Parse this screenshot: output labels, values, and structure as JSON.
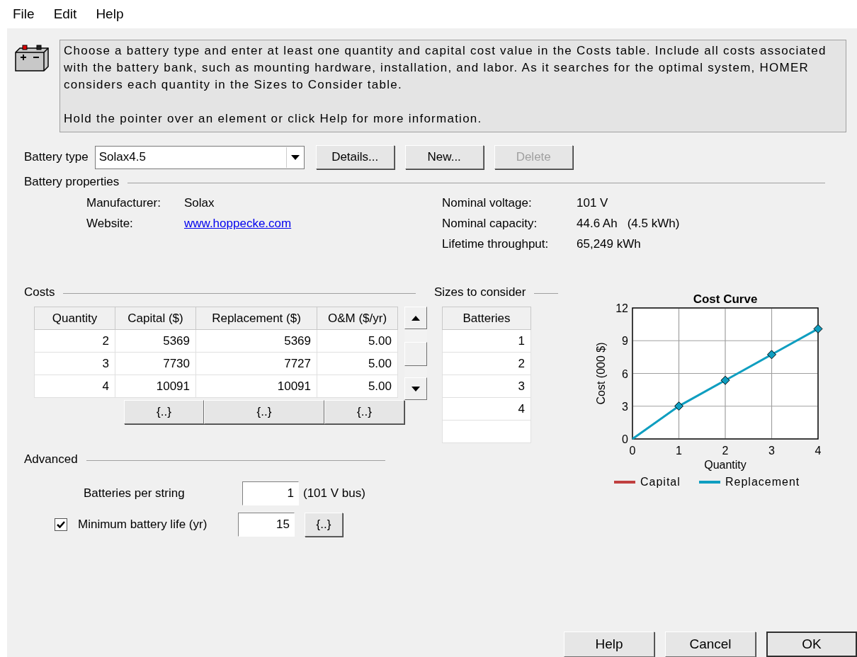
{
  "menu": [
    {
      "label": "File"
    },
    {
      "label": "Edit"
    },
    {
      "label": "Help"
    }
  ],
  "info": {
    "paragraphs": [
      "Choose a battery type and enter at least one quantity and capital cost value in the Costs table. Include all costs associated with the battery bank, such as mounting hardware, installation, and labor. As it searches for the optimal system, HOMER considers each quantity in the Sizes to Consider table.",
      "Hold the pointer over an element or click Help for more information."
    ]
  },
  "battery_type": {
    "label": "Battery type",
    "value": "Solax4.5",
    "buttons": [
      {
        "label": "Details...",
        "disabled": false
      },
      {
        "label": "New...",
        "disabled": false
      },
      {
        "label": "Delete",
        "disabled": true
      }
    ]
  },
  "battery_properties": {
    "title": "Battery properties",
    "left": [
      {
        "label": "Manufacturer:",
        "value": "Solax",
        "kind": "text"
      },
      {
        "label": "Website:",
        "value": "www.hoppecke.com",
        "kind": "link"
      }
    ],
    "right": [
      {
        "label": "Nominal voltage:",
        "value": "101 V"
      },
      {
        "label": "Nominal capacity:",
        "value": "44.6 Ah",
        "extra": "(4.5 kWh)"
      },
      {
        "label": "Lifetime throughput:",
        "value": "65,249 kWh"
      }
    ]
  },
  "costs": {
    "title": "Costs",
    "columns": [
      "Quantity",
      "Capital ($)",
      "Replacement ($)",
      "O&M ($/yr)"
    ],
    "rows": [
      [
        "2",
        "5369",
        "5369",
        "5.00"
      ],
      [
        "3",
        "7730",
        "7727",
        "5.00"
      ],
      [
        "4",
        "10091",
        "10091",
        "5.00"
      ]
    ],
    "column_buttons": [
      "{..}",
      "{..}",
      "{..}"
    ]
  },
  "sizes": {
    "title": "Sizes to consider",
    "column": "Batteries",
    "rows": [
      "1",
      "2",
      "3",
      "4"
    ]
  },
  "cost_curve": {
    "chart_data": {
      "type": "line",
      "title": "Cost Curve",
      "xlabel": "Quantity",
      "ylabel": "Cost (000 $)",
      "x": [
        0,
        1,
        2,
        3,
        4
      ],
      "series": [
        {
          "name": "Capital",
          "color": "#c04040",
          "values": [
            null,
            null,
            null,
            null,
            null
          ]
        },
        {
          "name": "Replacement",
          "color": "#0f9ec0",
          "marker": "diamond",
          "values": [
            0,
            3.01,
            5.37,
            7.73,
            10.09
          ]
        }
      ],
      "xlim": [
        0,
        4
      ],
      "ylim": [
        0,
        12
      ],
      "xticks": [
        0,
        1,
        2,
        3,
        4
      ],
      "yticks": [
        0,
        3,
        6,
        9,
        12
      ],
      "grid": true,
      "legend": true
    }
  },
  "advanced": {
    "title": "Advanced",
    "batteries_per_string": {
      "label": "Batteries per string",
      "value": "1",
      "note": "(101 V bus)"
    },
    "minimum_life": {
      "label": "Minimum battery life (yr)",
      "checked": true,
      "value": "15",
      "button": "{..}"
    }
  },
  "buttons": [
    {
      "label": "Help",
      "default": false
    },
    {
      "label": "Cancel",
      "default": false
    },
    {
      "label": "OK",
      "default": true
    }
  ]
}
